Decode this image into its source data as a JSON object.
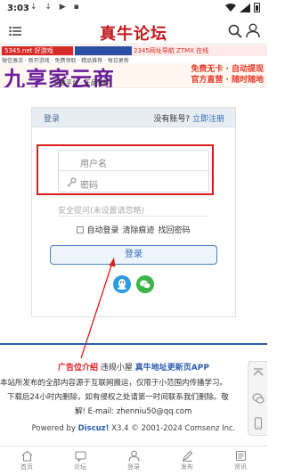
{
  "status_bar": {
    "time": "3:03",
    "notifications": "↓ ↓ ▶ ▪"
  },
  "header": {
    "logo": "真牛论坛"
  },
  "ads": {
    "strip_left": "5345.net 好游戏 ",
    "strip_right": "2345网址导航  ZTMX 在线",
    "line2": "微信激活 · 新开游戏 · 免费领取 · 精品推荐 · 每日更新",
    "big_title": "九享家云商",
    "sub": "开放平台 · 正品保障",
    "side_line1": "免费无卡 · 自动提现",
    "side_line2": "官方直营 · 随时随地"
  },
  "login": {
    "title": "登录",
    "register_prefix": "没有账号?",
    "register_link": "立即注册",
    "username_placeholder": "用户名",
    "password_placeholder": "密码",
    "security_question": "安全提问(未设置请忽略)",
    "auto_login": "自动登录",
    "clear_traces": "清除痕迹",
    "recover_password": "找回密码",
    "login_button": "登录"
  },
  "footer": {
    "ad_intro": "广告位介绍",
    "violation": "违规小屋",
    "new_url": "真牛地址更新页APP",
    "notice_line1": "本站所发布的全部内容源于互联网搬运，仅限于小范围内传播学习。",
    "notice_line2": "下载后24小时内删除，如有侵权之处请第一时间联系我们删除。敬",
    "notice_line3": "解! E-mail: zhenniu50@qq.com",
    "powered_prefix": "Powered by",
    "powered_brand": "Discuz!",
    "powered_suffix": "X3.4 © 2001-2024 Comsenz Inc."
  },
  "bottom_nav": [
    {
      "label": "首页"
    },
    {
      "label": "论坛"
    },
    {
      "label": "登录"
    },
    {
      "label": "发布"
    },
    {
      "label": "资讯"
    }
  ],
  "colors": {
    "brand_red": "#c0181c",
    "link_blue": "#2f6db7",
    "footer_blue": "#2f5fae",
    "annotation_red": "#e01b1b"
  }
}
